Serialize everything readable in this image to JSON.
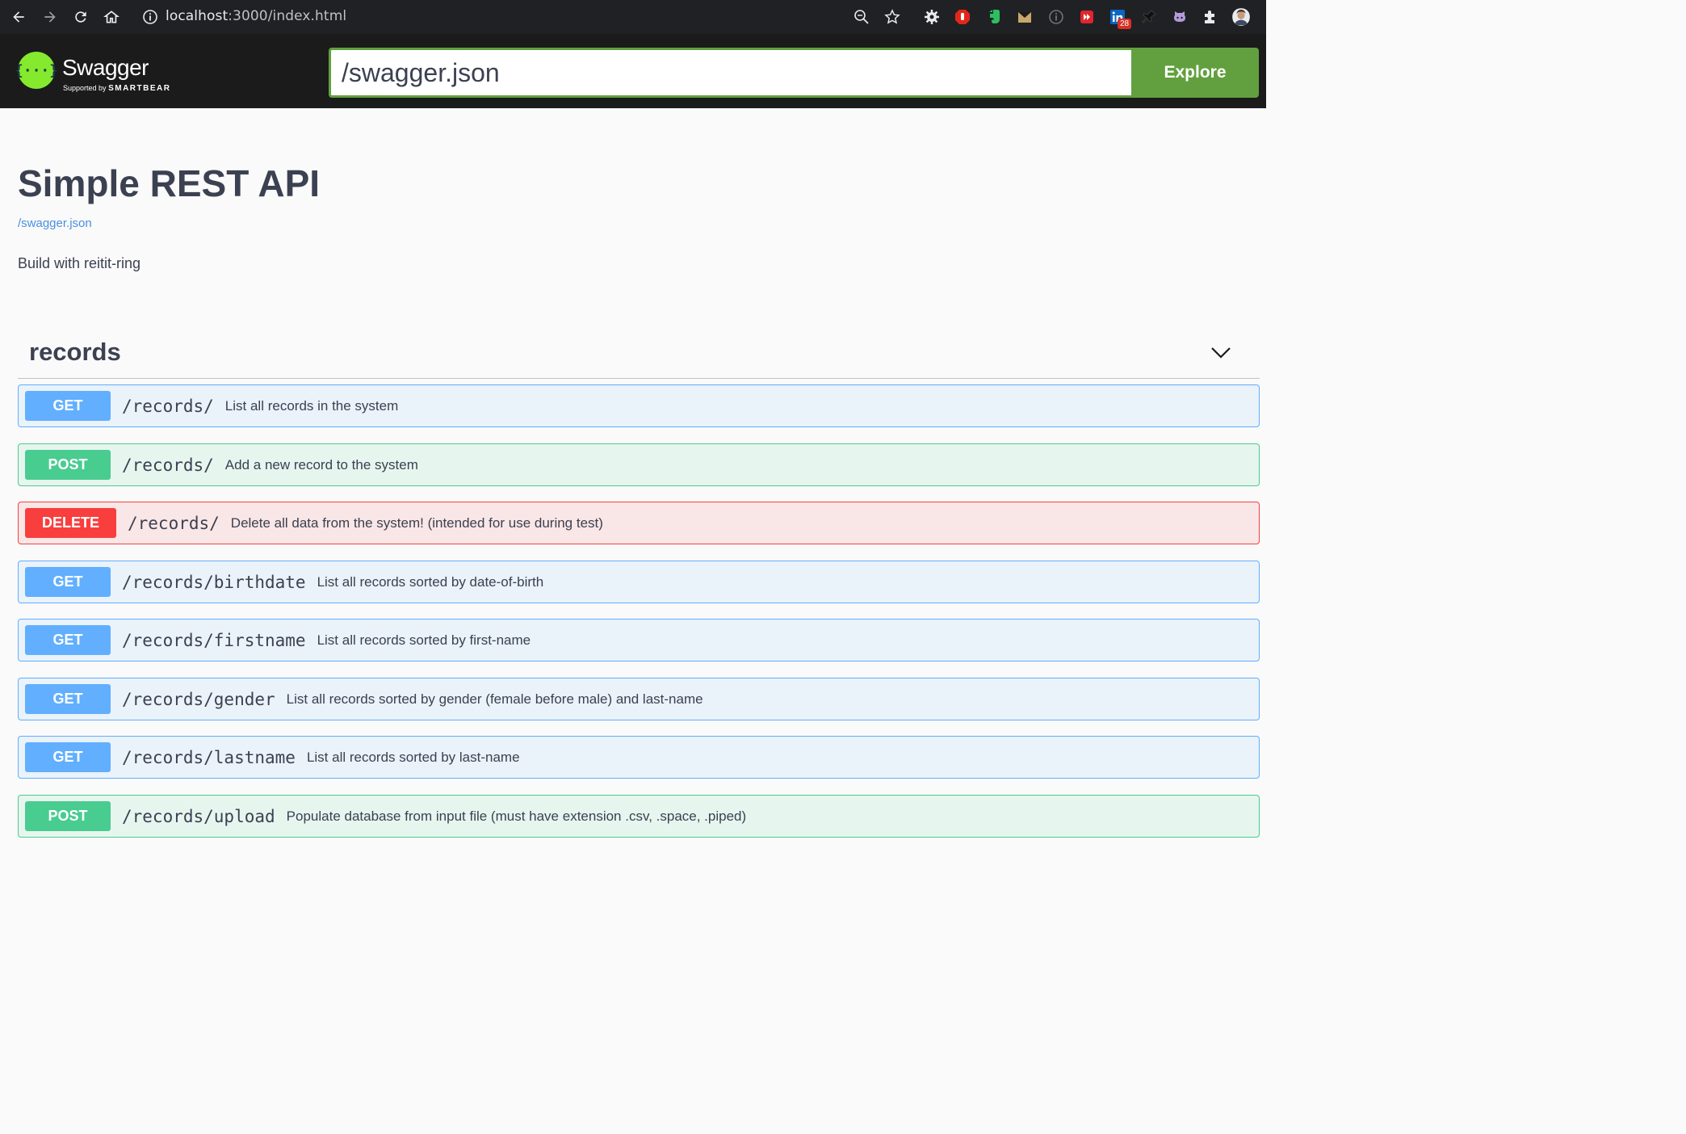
{
  "browser": {
    "url_host": "localhost",
    "url_rest": ":3000/index.html",
    "extension_badge": "28"
  },
  "topbar": {
    "logo_title": "Swagger",
    "logo_supported": "Supported by",
    "logo_company": "SMARTBEAR",
    "logo_glyph": "{···}",
    "spec_url": "/swagger.json",
    "explore_label": "Explore"
  },
  "info": {
    "title": "Simple REST API",
    "spec_link": "/swagger.json",
    "description": "Build with reitit-ring"
  },
  "tag": {
    "name": "records"
  },
  "operations": [
    {
      "method": "GET",
      "path": "/records/",
      "summary": "List all records in the system"
    },
    {
      "method": "POST",
      "path": "/records/",
      "summary": "Add a new record to the system"
    },
    {
      "method": "DELETE",
      "path": "/records/",
      "summary": "Delete all data from the system! (intended for use during test)"
    },
    {
      "method": "GET",
      "path": "/records/birthdate",
      "summary": "List all records sorted by date-of-birth"
    },
    {
      "method": "GET",
      "path": "/records/firstname",
      "summary": "List all records sorted by first-name"
    },
    {
      "method": "GET",
      "path": "/records/gender",
      "summary": "List all records sorted by gender (female before male) and last-name"
    },
    {
      "method": "GET",
      "path": "/records/lastname",
      "summary": "List all records sorted by last-name"
    },
    {
      "method": "POST",
      "path": "/records/upload",
      "summary": "Populate database from input file (must have extension .csv, .space, .piped)"
    }
  ],
  "colors": {
    "get": "#61affe",
    "post": "#49cc90",
    "delete": "#f93e3e",
    "explore": "#62a03f",
    "logo": "#85ea2d"
  }
}
